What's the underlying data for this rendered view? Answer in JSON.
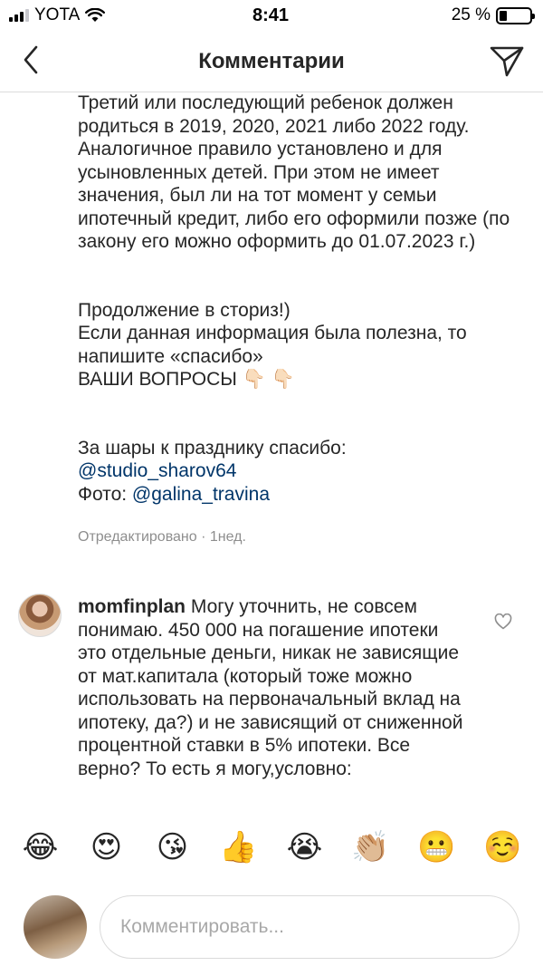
{
  "status_bar": {
    "carrier": "YOTA",
    "time": "8:41",
    "battery_percent_label": "25 %",
    "battery_level": 0.25
  },
  "header": {
    "title": "Комментарии",
    "back_icon": "chevron-left-icon",
    "send_icon": "paper-plane-icon"
  },
  "caption": {
    "p1": "Третий или последующий ребенок должен родиться в 2019, 2020, 2021 либо 2022 году. Аналогичное правило установлено и для усыновленных детей. При этом не имеет значения, был ли на тот момент у семьи ипотечный кредит, либо его оформили позже (по закону его можно оформить до 01.07.2023 г.)",
    "p2_line1": "Продолжение в сториз!)",
    "p2_line2": "Если данная информация была полезна, то напишите «спасибо»",
    "p2_line3": " ВАШИ ВОПРОСЫ",
    "p2_emoji": "👇🏻 👇🏻",
    "p3_line1": "За шары к празднику спасибо:",
    "p3_mention1": "@studio_sharov64",
    "p3_photo_label": "Фото: ",
    "p3_mention2": "@galina_travina",
    "meta": "Отредактировано · 1нед."
  },
  "comment": {
    "username": "momfinplan",
    "text": " Могу уточнить, не совсем понимаю. 450 000 на погашение ипотеки это отдельные деньги, никак не зависящие от мат.капитала (который тоже можно использовать на первоначальный вклад на ипотеку, да?) и не зависящий от сниженной процентной ставки в 5% ипотеки. Все верно? То есть я могу,условно:",
    "like_icon": "heart-outline-icon"
  },
  "emoji_bar": [
    "😂",
    "😍",
    "😘",
    "👍",
    "😭",
    "👏🏼",
    "😬",
    "☺️"
  ],
  "input": {
    "placeholder": "Комментировать..."
  }
}
